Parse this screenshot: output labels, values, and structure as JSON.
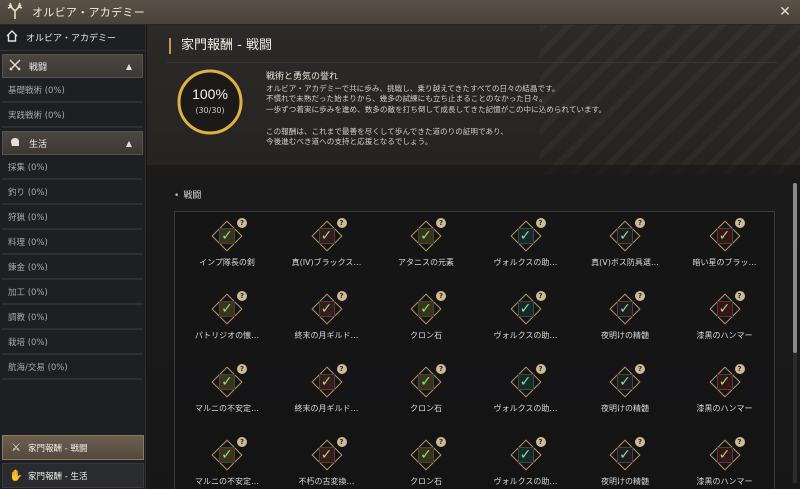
{
  "window": {
    "title": "オルビア・アカデミー",
    "close_glyph": "✕",
    "logo_icon": "deer-antler-icon"
  },
  "sidebar": {
    "home_label": "オルビア・アカデミー",
    "sections": [
      {
        "label": "戦闘",
        "icon": "crossed-swords-icon",
        "items": [
          "基礎戦術 (0%)",
          "実践戦術 (0%)"
        ]
      },
      {
        "label": "生活",
        "icon": "hand-icon",
        "items": [
          "採集 (0%)",
          "釣り (0%)",
          "狩猟 (0%)",
          "料理 (0%)",
          "錬金 (0%)",
          "加工 (0%)",
          "調教 (0%)",
          "栽培 (0%)",
          "航海/交易 (0%)"
        ]
      }
    ],
    "bottom_tabs": [
      {
        "label": "家門報酬 - 戦闘",
        "active": true
      },
      {
        "label": "家門報酬 - 生活",
        "active": false
      }
    ]
  },
  "main": {
    "title": "家門報酬 - 戦闘",
    "progress": {
      "percent_text": "100%",
      "fraction_text": "(30/30)",
      "value": 1.0,
      "ring_color": "#e1b13d"
    },
    "desc_title": "戦術と勇気の誉れ",
    "desc_lines": [
      "オルビア・アカデミーで共に歩み、挑戦し、乗り越えてきたすべての日々の結晶です。",
      "不慣れで未熟だった始まりから、幾多の試練にも立ち止まることのなかった日々。",
      "一歩ずつ着実に歩みを進め、数多の敵を打ち倒して成長してきた記憶がこの中に込められています。"
    ],
    "desc2_lines": [
      "この報酬は、これまで最善を尽くして歩んできた道のりの証明であり、",
      "今後進むべき道への支持と応援となるでしょう。"
    ],
    "category_label": "戦闘",
    "rewards": [
      [
        "インプ隊長の剣",
        "真(IV)ブラックス…",
        "アタニスの元素",
        "ヴォルクスの助…",
        "真(V)ボス防具選…",
        "暗い星のブラッ…"
      ],
      [
        "パトリジオの懐…",
        "終末の月ギルド…",
        "クロン石",
        "ヴォルクスの助…",
        "夜明けの精髄",
        "漆黒のハンマー"
      ],
      [
        "マルニの不安定…",
        "終末の月ギルド…",
        "クロン石",
        "ヴォルクスの助…",
        "夜明けの精髄",
        "漆黒のハンマー"
      ],
      [
        "マルニの不安定…",
        "不朽の古変換…",
        "クロン石",
        "ヴォルクスの助…",
        "夜明けの精髄",
        "漆黒のハンマー"
      ]
    ],
    "item_colors": [
      "#3c3418",
      "#3a1a1a",
      "#3a3416",
      "#152a2a",
      "#1e1e22",
      "#3a1414"
    ]
  }
}
